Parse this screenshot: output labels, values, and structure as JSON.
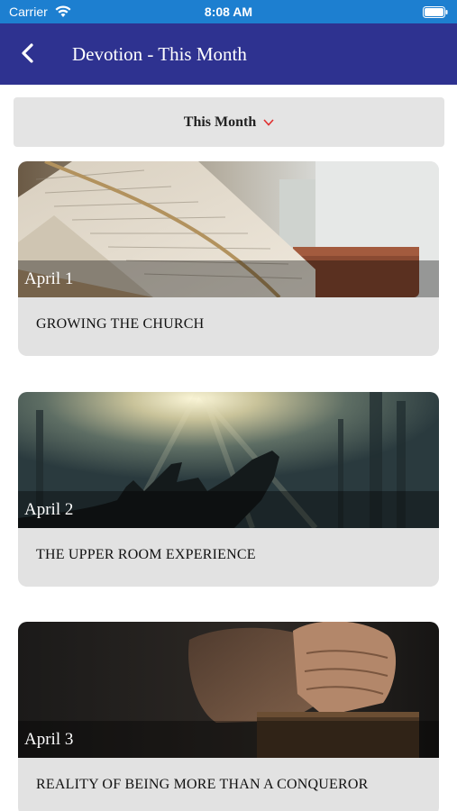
{
  "status_bar": {
    "carrier": "Carrier",
    "time": "8:08 AM"
  },
  "nav": {
    "title": "Devotion - This Month"
  },
  "filter": {
    "selected": "This Month"
  },
  "devotions": [
    {
      "date": "April 1",
      "title": "GROWING THE CHURCH",
      "image": "open-bible"
    },
    {
      "date": "April 2",
      "title": "THE UPPER ROOM EXPERIENCE",
      "image": "hands-raised-in-light"
    },
    {
      "date": "April 3",
      "title": "REALITY OF BEING MORE THAN A CONQUEROR",
      "image": "praying-hands"
    }
  ],
  "colors": {
    "nav_bar": "#2e3290",
    "status_bar": "#1d7fd0",
    "chevron_accent": "#e03030"
  }
}
